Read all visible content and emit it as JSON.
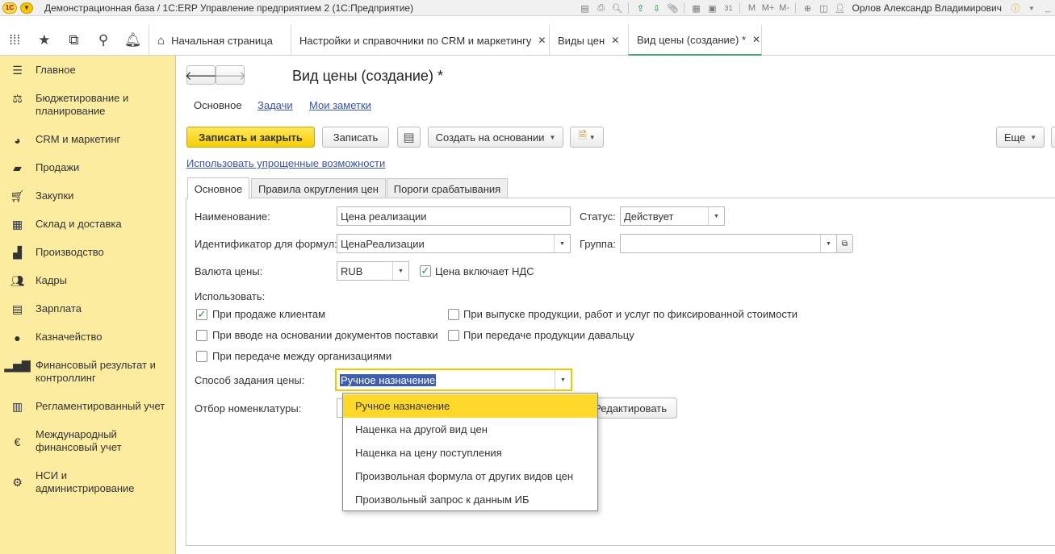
{
  "titlebar": {
    "logo_text": "1С",
    "title": "Демонстрационная база / 1С:ERP Управление предприятием 2  (1С:Предприятие)",
    "m_labels": [
      "M",
      "M+",
      "M-"
    ],
    "user": "Орлов Александр Владимирович"
  },
  "tabs": [
    {
      "label": "Начальная страница"
    },
    {
      "label": "Настройки и справочники по CRM и маркетингу",
      "close": "✕"
    },
    {
      "label": "Виды цен",
      "close": "✕"
    },
    {
      "label": "Вид цены (создание) *",
      "close": "✕"
    }
  ],
  "sidebar": {
    "items": [
      {
        "label": "Главное",
        "icon": "menu-icon"
      },
      {
        "label": "Бюджетирование и планирование",
        "icon": "budget-icon"
      },
      {
        "label": "CRM и маркетинг",
        "icon": "pie-chart-icon"
      },
      {
        "label": "Продажи",
        "icon": "bag-icon"
      },
      {
        "label": "Закупки",
        "icon": "cart-icon"
      },
      {
        "label": "Склад и доставка",
        "icon": "warehouse-icon"
      },
      {
        "label": "Производство",
        "icon": "factory-icon"
      },
      {
        "label": "Кадры",
        "icon": "people-icon"
      },
      {
        "label": "Зарплата",
        "icon": "calculator-icon"
      },
      {
        "label": "Казначейство",
        "icon": "coin-icon"
      },
      {
        "label": "Финансовый результат и контроллинг",
        "icon": "bar-chart-icon"
      },
      {
        "label": "Регламентированный учет",
        "icon": "books-icon"
      },
      {
        "label": "Международный финансовый учет",
        "icon": "euro-icon"
      },
      {
        "label": "НСИ и администрирование",
        "icon": "gear-icon"
      }
    ]
  },
  "form": {
    "title": "Вид цены (создание) *",
    "nav_links": {
      "main": "Основное",
      "tasks": "Задачи",
      "notes": "Мои заметки"
    },
    "buttons": {
      "save_close": "Записать и закрыть",
      "save": "Записать",
      "create_based": "Создать на основании",
      "more": "Еще"
    },
    "simplified_link": "Использовать упрощенные возможности",
    "tabs": [
      "Основное",
      "Правила округления цен",
      "Пороги срабатывания"
    ],
    "fields": {
      "name_label": "Наименование:",
      "name_value": "Цена реализации",
      "status_label": "Статус:",
      "status_value": "Действует",
      "formula_id_label": "Идентификатор для формул:",
      "formula_id_value": "ЦенаРеализации",
      "group_label": "Группа:",
      "group_value": "",
      "currency_label": "Валюта цены:",
      "currency_value": "RUB",
      "vat_label": "Цена включает НДС",
      "vat_checked": true,
      "use_label": "Использовать:",
      "method_label": "Способ задания цены:",
      "method_value": "Ручное назначение",
      "filter_label": "Отбор номенклатуры:",
      "edit_button": "Редактировать"
    },
    "checkboxes": [
      {
        "label": "При продаже клиентам",
        "checked": true
      },
      {
        "label": "При выпуске продукции, работ и услуг по фиксированной стоимости",
        "checked": false
      },
      {
        "label": "При вводе на основании документов поставки",
        "checked": false
      },
      {
        "label": "При передаче продукции давальцу",
        "checked": false
      },
      {
        "label": "При передаче между организациями",
        "checked": false
      }
    ],
    "dropdown_options": [
      {
        "label": "Ручное назначение",
        "selected": true
      },
      {
        "label": "Наценка на другой вид цен",
        "selected": false
      },
      {
        "label": "Наценка на цену поступления",
        "selected": false
      },
      {
        "label": "Произвольная формула от других видов цен",
        "selected": false
      },
      {
        "label": "Произвольный запрос к данным ИБ",
        "selected": false
      }
    ]
  },
  "colors": {
    "sidebar_bg": "#fbeca0",
    "primary_button": "#f5cf00",
    "selected_option": "#ffd92a",
    "link": "#3a55a8",
    "active_tab_underline": "#4aa56a"
  }
}
